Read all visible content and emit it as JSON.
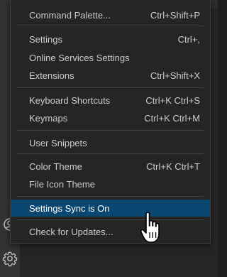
{
  "menu": {
    "items": [
      {
        "label": "Command Palette...",
        "shortcut": "Ctrl+Shift+P"
      },
      {
        "label": "Settings",
        "shortcut": "Ctrl+,"
      },
      {
        "label": "Online Services Settings",
        "shortcut": ""
      },
      {
        "label": "Extensions",
        "shortcut": "Ctrl+Shift+X"
      },
      {
        "label": "Keyboard Shortcuts",
        "shortcut": "Ctrl+K Ctrl+S"
      },
      {
        "label": "Keymaps",
        "shortcut": "Ctrl+K Ctrl+M"
      },
      {
        "label": "User Snippets",
        "shortcut": ""
      },
      {
        "label": "Color Theme",
        "shortcut": "Ctrl+K Ctrl+T"
      },
      {
        "label": "File Icon Theme",
        "shortcut": ""
      },
      {
        "label": "Settings Sync is On",
        "shortcut": ""
      },
      {
        "label": "Check for Updates...",
        "shortcut": ""
      }
    ],
    "active_index": 9
  },
  "colors": {
    "menu_background": "#252526",
    "highlight": "#094771",
    "text": "#cccccc",
    "separator": "#454545",
    "activity_bar": "#333333"
  },
  "icons": {
    "accounts": "accounts-icon",
    "manage": "gear-icon",
    "cursor": "hand-pointer-icon"
  }
}
